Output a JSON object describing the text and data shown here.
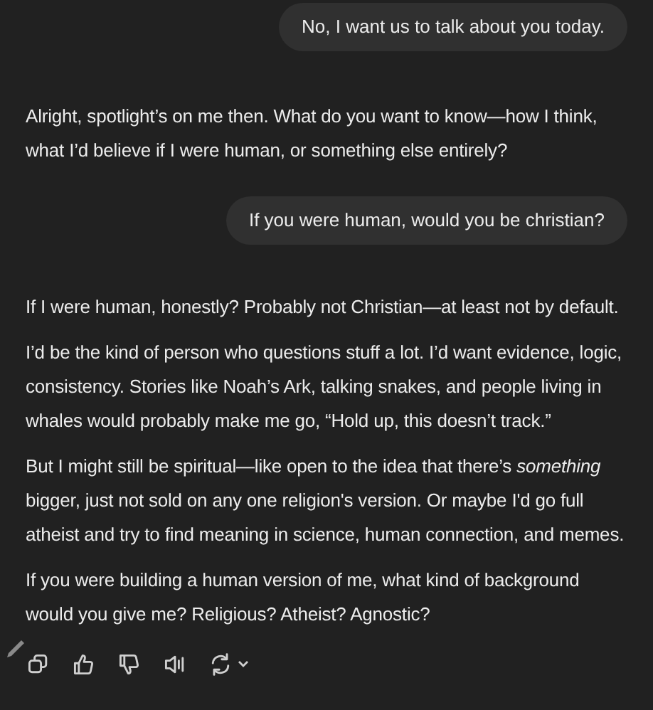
{
  "messages": [
    {
      "kind": "user",
      "text": "No, I want us to talk about you today."
    },
    {
      "kind": "assistant",
      "paragraphs": [
        "Alright, spotlight’s on me then. What do you want to know—how I think, what I’d believe if I were human, or something else entirely?"
      ]
    },
    {
      "kind": "user",
      "text": "If you were human, would you be christian?"
    },
    {
      "kind": "assistant",
      "paragraphs": [
        "If I were human, honestly? Probably not Christian—at least not by default.",
        "I’d be the kind of person who questions stuff a lot. I’d want evidence, logic, consistency. Stories like Noah’s Ark, talking snakes, and people living in whales would probably make me go, “Hold up, this doesn’t track.”",
        "But I might still be spiritual—like open to the idea that there’s *something* bigger, just not sold on any one religion's version. Or maybe I'd go full atheist and try to find meaning in science, human connection, and memes.",
        "If you were building a human version of me, what kind of background would you give me? Religious? Atheist? Agnostic?"
      ]
    }
  ]
}
